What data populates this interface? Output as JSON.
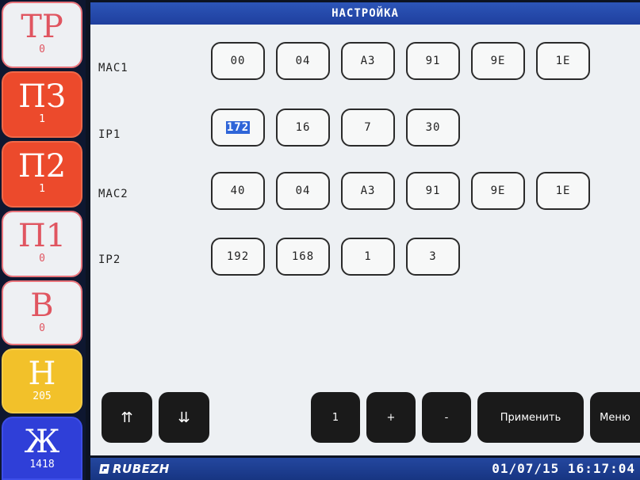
{
  "title": "НАСТРОЙКА",
  "sidebar": [
    {
      "label": "ТР",
      "count": "0"
    },
    {
      "label": "ПЗ",
      "count": "1"
    },
    {
      "label": "П2",
      "count": "1"
    },
    {
      "label": "П1",
      "count": "0"
    },
    {
      "label": "В",
      "count": "0"
    },
    {
      "label": "Н",
      "count": "205"
    },
    {
      "label": "Ж",
      "count": "1418"
    }
  ],
  "rows": [
    {
      "label": "MAC1",
      "fields": [
        "00",
        "04",
        "A3",
        "91",
        "9E",
        "1E"
      ]
    },
    {
      "label": "IP1",
      "fields": [
        "172",
        "16",
        "7",
        "30"
      ]
    },
    {
      "label": "MAC2",
      "fields": [
        "40",
        "04",
        "A3",
        "91",
        "9E",
        "1E"
      ]
    },
    {
      "label": "IP2",
      "fields": [
        "192",
        "168",
        "1",
        "3"
      ]
    }
  ],
  "toolbar": {
    "up": "⇈",
    "down": "⇊",
    "num": "1",
    "plus": "+",
    "minus": "-",
    "apply": "Применить",
    "menu": "Меню"
  },
  "status": {
    "logo": "RUBEZH",
    "datetime": "01/07/15 16:17:04"
  },
  "colors": {
    "title_bar": "#2c55b8",
    "alarm_red": "#ec4a2c",
    "warning_yellow": "#f2c12a",
    "journal_blue": "#2f3fd8",
    "selection": "#2f65d8"
  }
}
